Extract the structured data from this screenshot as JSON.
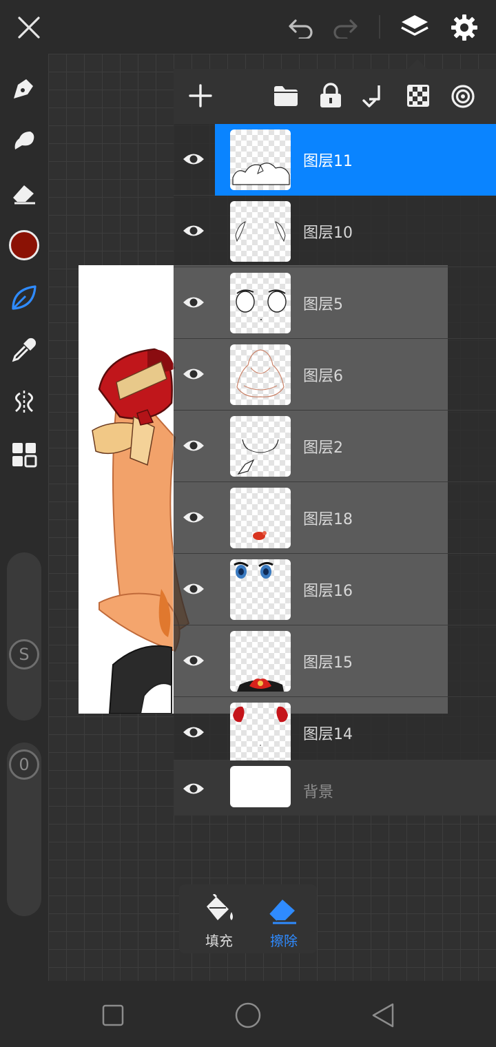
{
  "toolbar": {
    "close_icon": "close-icon",
    "undo_icon": "undo-icon",
    "redo_icon": "redo-icon",
    "layers_icon": "layers-icon",
    "settings_icon": "gear-icon"
  },
  "left_tools": {
    "tools": [
      "pen-icon",
      "smudge-icon",
      "eraser-icon",
      "color-swatch",
      "leaf-brush-icon",
      "eyedropper-icon",
      "symmetry-icon",
      "grid-icon"
    ],
    "current_color": "#8b1205",
    "active_tool_color": "#2f8bff",
    "size_label": "S",
    "opacity_label": "0"
  },
  "layers_panel": {
    "header_icons": [
      "add-icon",
      "folder-icon",
      "lock-icon",
      "merge-down-icon",
      "checker-icon",
      "target-icon"
    ],
    "layers": [
      {
        "name": "图层11",
        "selected": true
      },
      {
        "name": "图层10",
        "selected": false
      },
      {
        "name": "图层5",
        "selected": false
      },
      {
        "name": "图层6",
        "selected": false
      },
      {
        "name": "图层2",
        "selected": false
      },
      {
        "name": "图层18",
        "selected": false
      },
      {
        "name": "图层16",
        "selected": false
      },
      {
        "name": "图层15",
        "selected": false
      },
      {
        "name": "图层14",
        "selected": false
      }
    ],
    "background_label": "背景"
  },
  "fill_erase": {
    "fill_label": "填充",
    "erase_label": "擦除",
    "active": "erase"
  },
  "colors": {
    "accent": "#0a84ff",
    "panel": "#333333",
    "hair": "#f4a36a",
    "bow_red": "#c0161b"
  }
}
